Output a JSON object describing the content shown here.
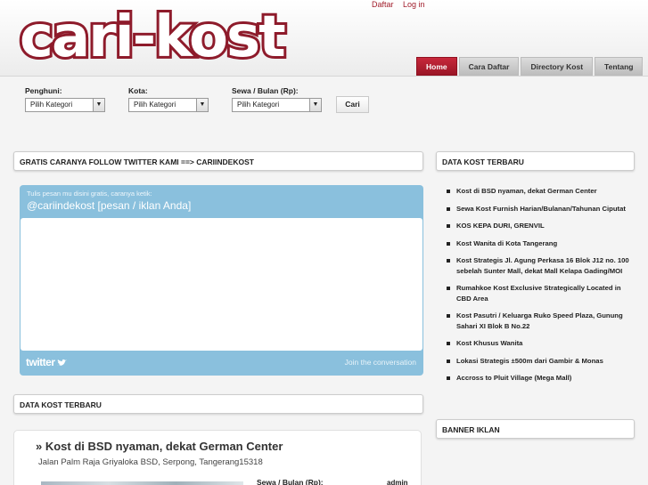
{
  "header": {
    "logo_text": "cari-kost",
    "top_links": [
      "Daftar",
      "Log in"
    ],
    "nav": [
      "Home",
      "Cara Daftar",
      "Directory Kost",
      "Tentang"
    ],
    "active_nav": "Home",
    "brand_color": "#8e1b2b"
  },
  "search": {
    "penghuni_label": "Penghuni:",
    "kota_label": "Kota:",
    "sewa_label": "Sewa / Bulan (Rp):",
    "penghuni_value": "Pilih Kategori",
    "kota_value": "Pilih Kategori",
    "sewa_value": "Pilih Kategori",
    "button": "Cari"
  },
  "twitter_box": {
    "title": "GRATIS CARANYA FOLLOW TWITTER KAMI ==> CARIINDEKOST",
    "hint": "Tulis pesan mu disini gratis, caranya ketik:",
    "handle": "@cariindekost [pesan / iklan Anda]",
    "logo": "twitter",
    "join": "Join the conversation"
  },
  "sidebar": {
    "title": "DATA KOST TERBARU",
    "items": [
      "Kost di BSD nyaman, dekat German Center",
      "Sewa Kost Furnish Harian/Bulanan/Tahunan Ciputat",
      "KOS KEPA DURI, GRENVIL",
      "Kost Wanita di Kota Tangerang",
      "Kost Strategis Jl. Agung Perkasa 16 Blok J12 no. 100 sebelah Sunter Mall, dekat Mall Kelapa Gading/MOI",
      "Rumahkoe Kost Exclusive Strategically Located in CBD Area",
      "Kost Pasutri / Keluarga Ruko Speed Plaza, Gunung Sahari XI Blok B No.22",
      "Kost Khusus Wanita",
      "Lokasi Strategis ±500m dari Gambir & Monas",
      "Accross to Pluit Village (Mega Mall)"
    ],
    "banner_title": "BANNER IKLAN"
  },
  "main": {
    "latest_title": "DATA KOST TERBARU",
    "listing_title": "» Kost di BSD nyaman, dekat German Center",
    "listing_address": "Jalan Palm Raja Griyaloka BSD, Serpong, Tangerang15318",
    "listing_sewa_label": "Sewa / Bulan (Rp):",
    "listing_author": "admin"
  }
}
